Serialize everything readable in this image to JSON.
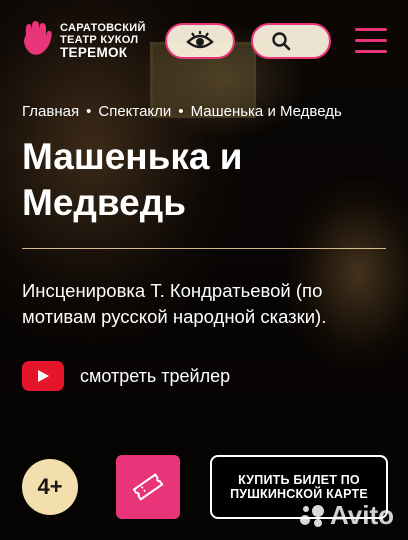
{
  "header": {
    "logo": {
      "line1": "САРАТОВСКИЙ",
      "line2": "ТЕАТР КУКОЛ",
      "line3": "ТЕРЕМОК",
      "icon": "hand-logo-icon"
    },
    "accessibility_icon": "eye-icon",
    "search_icon": "search-icon",
    "menu_icon": "hamburger-menu-icon"
  },
  "breadcrumb": {
    "items": [
      "Главная",
      "Спектакли",
      "Машенька и Медведь"
    ],
    "separator": "•"
  },
  "title": "Машенька и Медведь",
  "description": "Инсценировка Т. Кондратьевой (по мотивам русской народной сказки).",
  "trailer": {
    "label": "смотреть трейлер",
    "icon": "youtube-play-icon"
  },
  "actions": {
    "age_rating": "4+",
    "ticket_icon": "ticket-icon",
    "pushkin_card_label": "КУПИТЬ БИЛЕТ ПО ПУШКИНСКОЙ КАРТЕ"
  },
  "watermark": {
    "text": "Avito"
  },
  "colors": {
    "accent_pink": "#e8357a",
    "cream": "#f3dfae",
    "youtube_red": "#e5152a",
    "divider": "#f2d7a0"
  }
}
